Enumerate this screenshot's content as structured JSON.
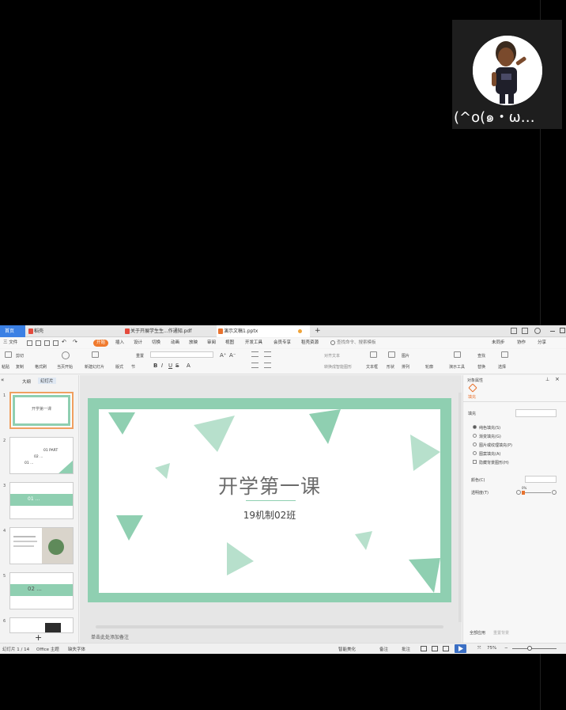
{
  "video": {
    "participant_name": "(^o(๑・ω…"
  },
  "wps": {
    "tabs": {
      "home": "首页",
      "daoke": "稻壳",
      "pdf": "关于开展学生生...作通知.pdf",
      "ppt": "演示文稿1.pptx",
      "add": "+"
    },
    "menu": {
      "file": "三 文件",
      "items": [
        "开始",
        "插入",
        "设计",
        "切换",
        "动画",
        "放映",
        "审阅",
        "视图",
        "开发工具",
        "会员专享",
        "稻壳资源"
      ],
      "search": "查找命令、搜索模板",
      "sync": "未同步",
      "collab": "协作",
      "share": "分享"
    },
    "ribbon": {
      "paste": "粘贴",
      "cut": "剪切",
      "copy": "复制",
      "format_painter": "格式刷",
      "from_start": "当页开始",
      "new_slide": "新建幻灯片",
      "layout": "版式",
      "section": "节",
      "reset": "重置",
      "text_box": "文本框",
      "shape": "形状",
      "arrange": "排列",
      "picture": "图片",
      "outline": "轮廓",
      "slide_tools": "演示工具",
      "replace": "替换",
      "select": "选择",
      "find": "查找",
      "align_text": "对齐文本",
      "convert_smartart": "转换成智能图形"
    },
    "left_panel": {
      "tab_outline": "大纲",
      "tab_slides": "幻灯片",
      "slide_numbers": [
        "1",
        "2",
        "3",
        "4",
        "5",
        "6"
      ],
      "thumb1_title": "开学第一课",
      "thumb2_text1": "01 PART",
      "thumb2_text2": "02 ...",
      "thumb2_text3": "01 ...",
      "thumb3_text": "01 ...",
      "thumb5_text": "02 ...",
      "add": "+"
    },
    "slide": {
      "title": "开学第一课",
      "subtitle": "19机制02班"
    },
    "notes_placeholder": "单击此处添加备注",
    "right_panel": {
      "header": "对象属性",
      "tab": "填充",
      "section": "填充",
      "options": [
        "纯色填充(S)",
        "渐变填充(G)",
        "图片或纹理填充(P)",
        "图案填充(A)",
        "隐藏背景图形(H)"
      ],
      "color_label": "颜色(C)",
      "transparency_label": "透明度(T)",
      "transparency_value": "0%",
      "apply_all": "全部应用",
      "reset_bg": "重置背景"
    },
    "status": {
      "slide_count": "幻灯片 1 / 14",
      "theme": "Office 主题",
      "font_missing": "缺失字体",
      "smart_beautify": "智能美化",
      "notes": "备注",
      "comments": "批注",
      "zoom": "75%"
    }
  }
}
